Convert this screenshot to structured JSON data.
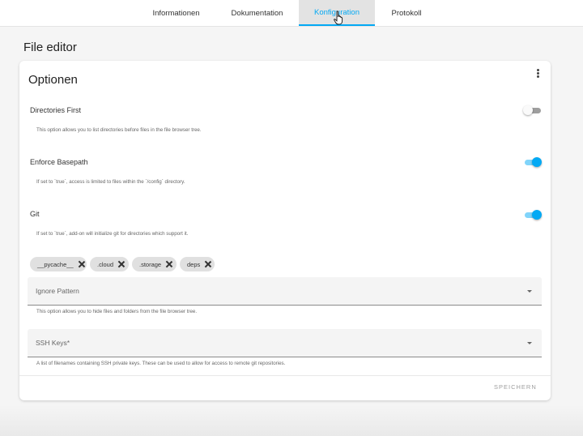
{
  "tabs": [
    {
      "label": "Informationen"
    },
    {
      "label": "Dokumentation"
    },
    {
      "label": "Konfiguration"
    },
    {
      "label": "Protokoll"
    }
  ],
  "active_tab_index": 2,
  "page": {
    "title": "File editor"
  },
  "card": {
    "title": "Optionen",
    "options": [
      {
        "label": "Directories First",
        "description": "This option allows you to list directories before files in the file browser tree.",
        "enabled": false
      },
      {
        "label": "Enforce Basepath",
        "description": "If set to `true`, access is limited to files within the `/config` directory.",
        "enabled": true
      },
      {
        "label": "Git",
        "description": "If set to `true`, add-on will initialize git for directories which support it.",
        "enabled": true
      }
    ],
    "chips": [
      "__pycache__",
      ".cloud",
      ".storage",
      "deps"
    ],
    "ignore_pattern": {
      "placeholder": "Ignore Pattern",
      "helper": "This option allows you to hide files and folders from the file browser tree."
    },
    "ssh_keys": {
      "placeholder": "SSH Keys*",
      "helper": "A list of filenames containing SSH private keys. These can be used to allow for access to remote git repositories."
    },
    "save_label": "SPEICHERN"
  },
  "colors": {
    "accent": "#03a9f4",
    "accent_light": "#81d4fa"
  },
  "icons": {
    "menu": "more-vert-icon",
    "chip_remove": "close-icon",
    "dropdown": "arrow-drop-down-icon",
    "cursor": "hand-pointer-icon"
  }
}
